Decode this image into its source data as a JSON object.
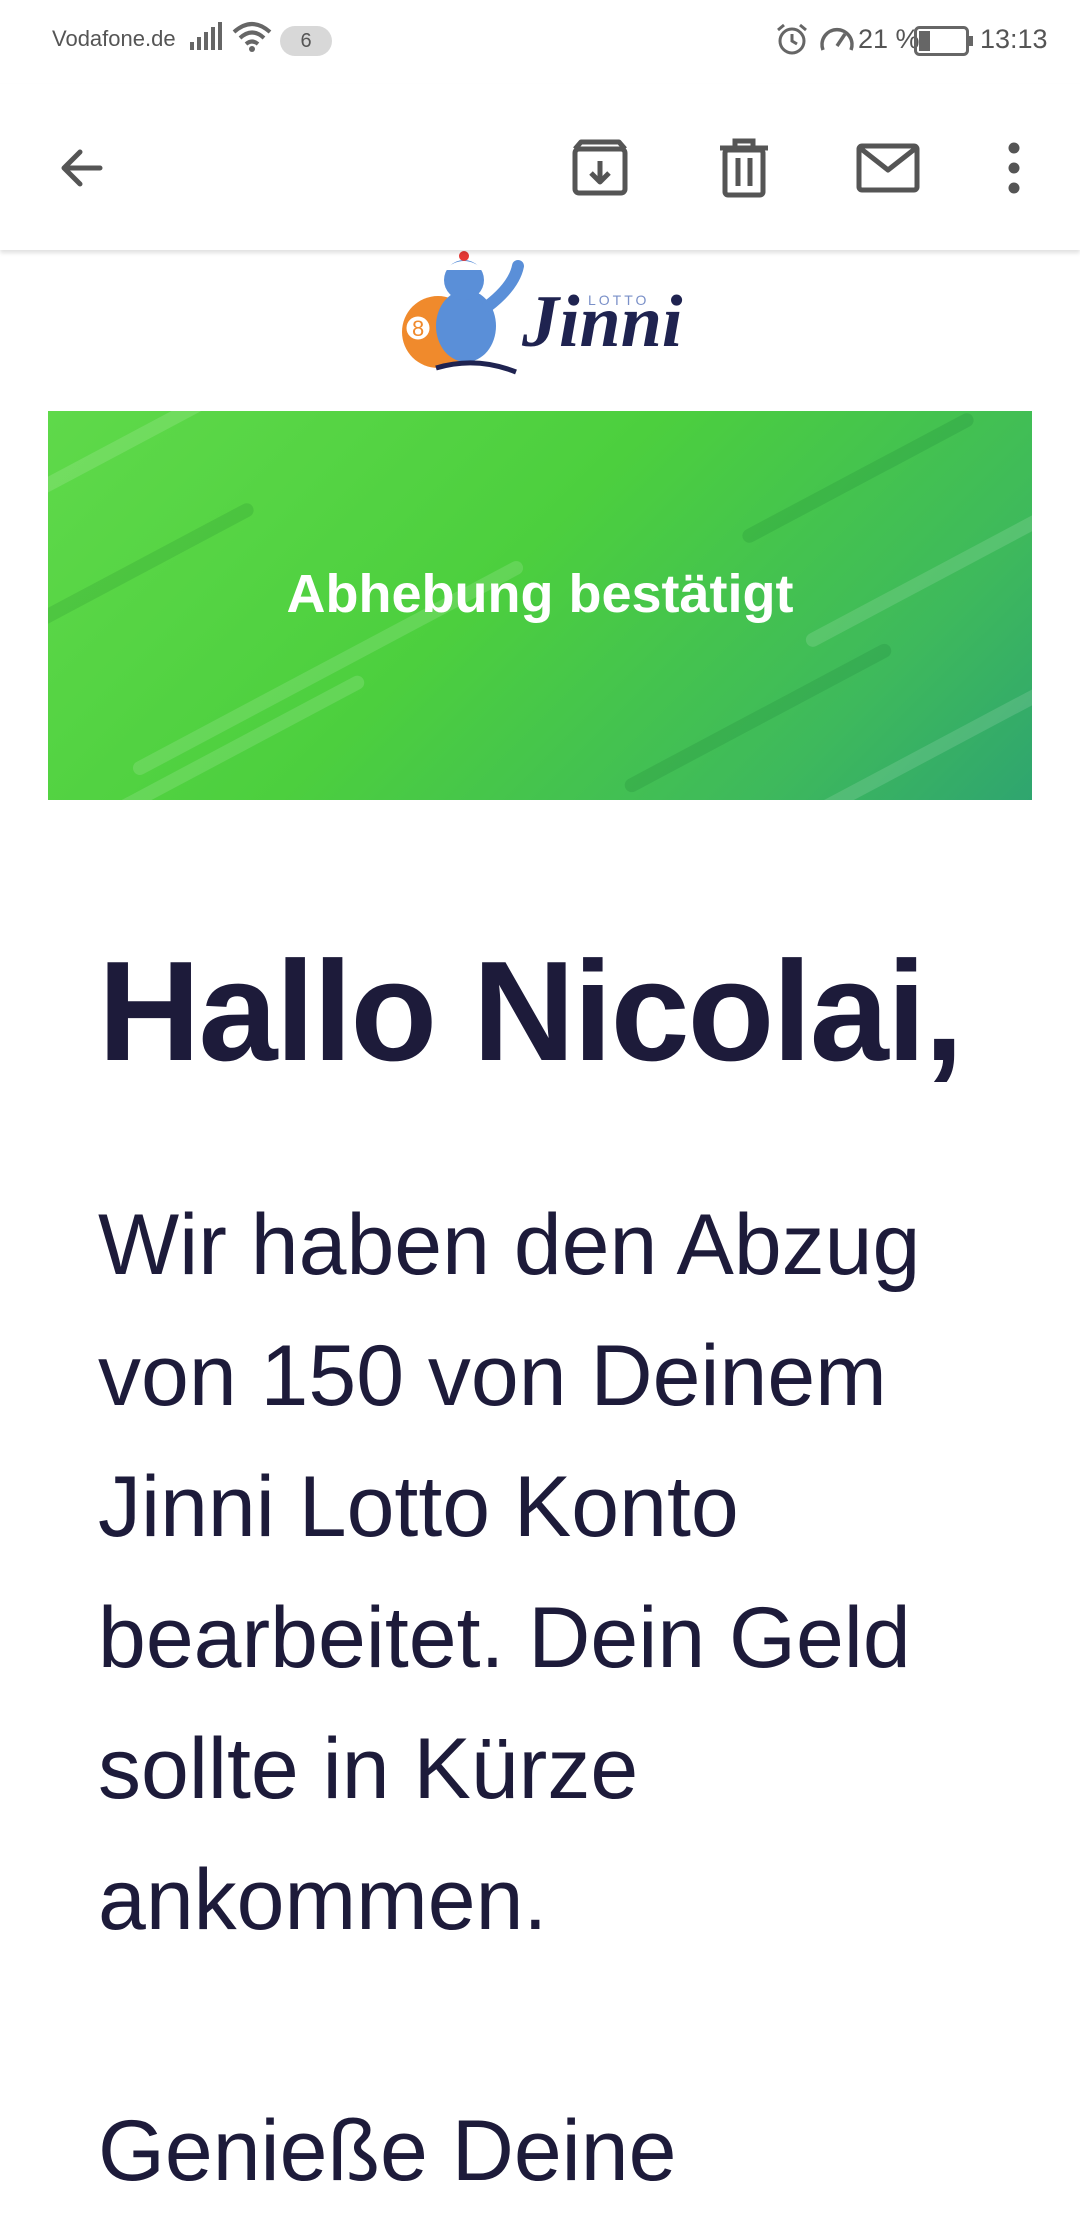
{
  "status_bar": {
    "carrier": "Vodafone.de",
    "notification_count": "6",
    "battery_percent": "21 %",
    "time": "13:13"
  },
  "app_bar": {
    "icons": [
      "back-arrow-icon",
      "archive-icon",
      "delete-icon",
      "mail-icon",
      "more-vertical-icon"
    ]
  },
  "email": {
    "logo": {
      "brand": "Jinni",
      "sub": "LOTTO"
    },
    "banner_title": "Abhebung bestätigt",
    "greeting": "Hallo Nicolai,",
    "paragraph": "Wir haben den Abzug von 150 von Deinem Jinni Lotto Konto bearbeitet. Dein Geld sollte in Kürze ankommen.",
    "paragraph2_start": "Genieße Deine"
  },
  "colors": {
    "banner_green": "#4ccf3e",
    "text_dark": "#1d1b3a",
    "logo_navy": "#1f2350",
    "logo_orange": "#f08a2c"
  }
}
